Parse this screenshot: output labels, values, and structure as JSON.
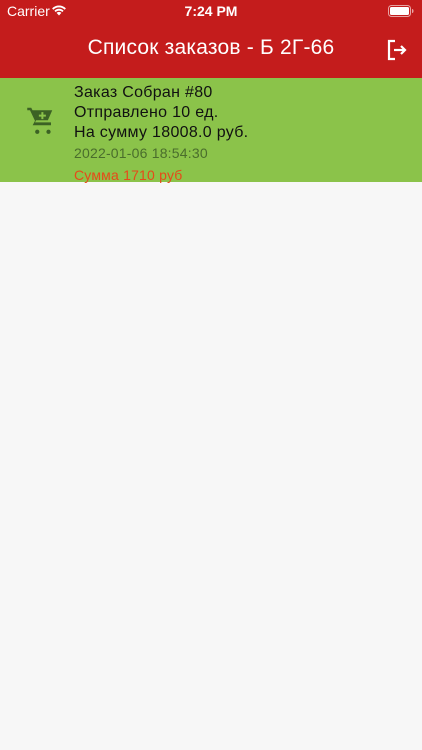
{
  "status_bar": {
    "carrier": "Carrier",
    "time": "7:24 PM"
  },
  "header": {
    "title": "Список заказов - Б 2Г-66",
    "logout_icon": "logout-icon",
    "background_color": "#c41c1c"
  },
  "orders": [
    {
      "icon": "cart-plus-icon",
      "title": "Заказ Собран #80",
      "sent": "Отправлено 10 ед.",
      "total": "На сумму 18008.0 руб.",
      "date": "2022-01-06 18:54:30",
      "sum": "Сумма 1710 руб",
      "background_color": "#8bc34a"
    }
  ]
}
